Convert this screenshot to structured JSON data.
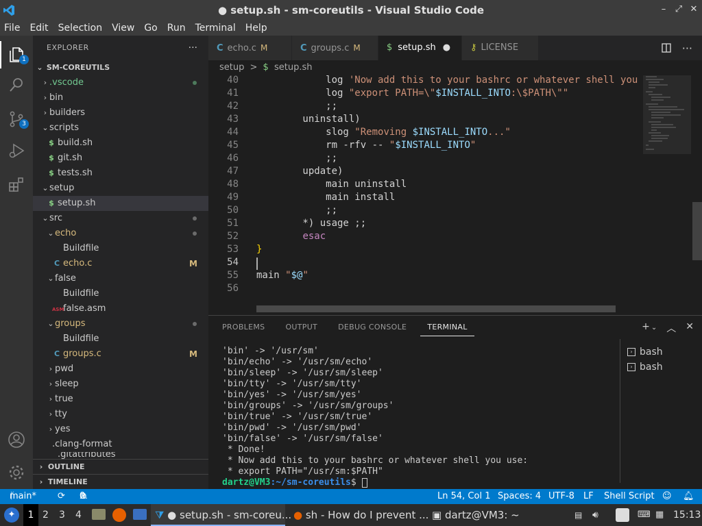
{
  "window": {
    "title": "● setup.sh - sm-coreutils - Visual Studio Code",
    "minimize_glyph": "–",
    "restore_glyph": "⤢",
    "close_glyph": "✕"
  },
  "menu": [
    "File",
    "Edit",
    "Selection",
    "View",
    "Go",
    "Run",
    "Terminal",
    "Help"
  ],
  "activity": {
    "explorer_badge": "1",
    "scm_badge": "3"
  },
  "sidebar": {
    "header": "EXPLORER",
    "more": "···",
    "root": "SM-COREUTILS",
    "items": [
      {
        "label": ".vscode",
        "indent": 1,
        "kind": "folder",
        "open": false,
        "color": "#73c991",
        "dot": true
      },
      {
        "label": "bin",
        "indent": 1,
        "kind": "folder",
        "open": false
      },
      {
        "label": "builders",
        "indent": 1,
        "kind": "folder",
        "open": false
      },
      {
        "label": "scripts",
        "indent": 1,
        "kind": "folder",
        "open": true
      },
      {
        "label": "build.sh",
        "indent": 2,
        "kind": "sh"
      },
      {
        "label": "git.sh",
        "indent": 2,
        "kind": "sh"
      },
      {
        "label": "tests.sh",
        "indent": 2,
        "kind": "sh"
      },
      {
        "label": "setup",
        "indent": 1,
        "kind": "folder",
        "open": true
      },
      {
        "label": "setup.sh",
        "indent": 2,
        "kind": "sh",
        "selected": true
      },
      {
        "label": "src",
        "indent": 1,
        "kind": "folder",
        "open": true,
        "dot": true
      },
      {
        "label": "echo",
        "indent": 2,
        "kind": "folder",
        "open": true,
        "color": "#d7ba7d",
        "dot": true
      },
      {
        "label": "Buildfile",
        "indent": 3,
        "kind": "plain"
      },
      {
        "label": "echo.c",
        "indent": 3,
        "kind": "c",
        "color": "#d7ba7d",
        "flag": "M"
      },
      {
        "label": "false",
        "indent": 2,
        "kind": "folder",
        "open": true
      },
      {
        "label": "Buildfile",
        "indent": 3,
        "kind": "plain"
      },
      {
        "label": "false.asm",
        "indent": 3,
        "kind": "asm"
      },
      {
        "label": "groups",
        "indent": 2,
        "kind": "folder",
        "open": true,
        "color": "#d7ba7d",
        "dot": true
      },
      {
        "label": "Buildfile",
        "indent": 3,
        "kind": "plain"
      },
      {
        "label": "groups.c",
        "indent": 3,
        "kind": "c",
        "color": "#d7ba7d",
        "flag": "M"
      },
      {
        "label": "pwd",
        "indent": 2,
        "kind": "folder",
        "open": false
      },
      {
        "label": "sleep",
        "indent": 2,
        "kind": "folder",
        "open": false
      },
      {
        "label": "true",
        "indent": 2,
        "kind": "folder",
        "open": false
      },
      {
        "label": "tty",
        "indent": 2,
        "kind": "folder",
        "open": false
      },
      {
        "label": "yes",
        "indent": 2,
        "kind": "folder",
        "open": false
      },
      {
        "label": ".clang-format",
        "indent": 1,
        "kind": "plain"
      }
    ],
    "partial_item": ".gitattributes",
    "outline": "OUTLINE",
    "timeline": "TIMELINE"
  },
  "tabs": [
    {
      "label": "echo.c",
      "icon": "C",
      "flag": "M",
      "active": false
    },
    {
      "label": "groups.c",
      "icon": "C",
      "flag": "M",
      "active": false
    },
    {
      "label": "setup.sh",
      "icon": "$",
      "flag": "●",
      "active": true
    },
    {
      "label": "LICENSE",
      "icon": "⚷",
      "flag": "",
      "active": false
    }
  ],
  "breadcrumb": {
    "folder": "setup",
    "sep": ">",
    "file": "setup.sh"
  },
  "code_lines": [
    {
      "n": "40",
      "segs": [
        [
          "            log ",
          "#d4d4d4"
        ],
        [
          "'Now add this to your bashrc or whatever shell you use:'",
          "#ce9178"
        ]
      ]
    },
    {
      "n": "41",
      "segs": [
        [
          "            log ",
          "#d4d4d4"
        ],
        [
          "\"export PATH=\\\"",
          "#ce9178"
        ],
        [
          "$INSTALL_INTO",
          "#9cdcfe"
        ],
        [
          ":\\$PATH\\\"\"",
          "#ce9178"
        ]
      ]
    },
    {
      "n": "42",
      "segs": [
        [
          "            ;;",
          "#d4d4d4"
        ]
      ]
    },
    {
      "n": "43",
      "segs": [
        [
          "        uninstall)",
          "#d4d4d4"
        ]
      ]
    },
    {
      "n": "44",
      "segs": [
        [
          "            slog ",
          "#d4d4d4"
        ],
        [
          "\"Removing ",
          "#ce9178"
        ],
        [
          "$INSTALL_INTO",
          "#9cdcfe"
        ],
        [
          "...\"",
          "#ce9178"
        ]
      ]
    },
    {
      "n": "45",
      "segs": [
        [
          "            rm -rfv -- ",
          "#d4d4d4"
        ],
        [
          "\"",
          "#ce9178"
        ],
        [
          "$INSTALL_INTO",
          "#9cdcfe"
        ],
        [
          "\"",
          "#ce9178"
        ]
      ]
    },
    {
      "n": "46",
      "segs": [
        [
          "            ;;",
          "#d4d4d4"
        ]
      ]
    },
    {
      "n": "47",
      "segs": [
        [
          "        update)",
          "#d4d4d4"
        ]
      ]
    },
    {
      "n": "48",
      "segs": [
        [
          "            main uninstall",
          "#d4d4d4"
        ]
      ]
    },
    {
      "n": "49",
      "segs": [
        [
          "            main install",
          "#d4d4d4"
        ]
      ]
    },
    {
      "n": "50",
      "segs": [
        [
          "            ;;",
          "#d4d4d4"
        ]
      ]
    },
    {
      "n": "51",
      "segs": [
        [
          "        *) usage ;;",
          "#d4d4d4"
        ]
      ]
    },
    {
      "n": "52",
      "segs": [
        [
          "        ",
          "#d4d4d4"
        ],
        [
          "esac",
          "#c586c0"
        ]
      ]
    },
    {
      "n": "53",
      "segs": [
        [
          "}",
          "#ffd700"
        ]
      ]
    },
    {
      "n": "54",
      "segs": [
        [
          "",
          "#d4d4d4"
        ]
      ]
    },
    {
      "n": "55",
      "segs": [
        [
          "main ",
          "#d4d4d4"
        ],
        [
          "\"",
          "#ce9178"
        ],
        [
          "$@",
          "#9cdcfe"
        ],
        [
          "\"",
          "#ce9178"
        ]
      ]
    },
    {
      "n": "56",
      "segs": [
        [
          "",
          "#d4d4d4"
        ]
      ]
    }
  ],
  "panel": {
    "tabs": [
      "PROBLEMS",
      "OUTPUT",
      "DEBUG CONSOLE",
      "TERMINAL"
    ],
    "active_tab": "TERMINAL",
    "add": "+",
    "terminal_lines": [
      "'bin' -> '/usr/sm'",
      "'bin/echo' -> '/usr/sm/echo'",
      "'bin/sleep' -> '/usr/sm/sleep'",
      "'bin/tty' -> '/usr/sm/tty'",
      "'bin/yes' -> '/usr/sm/yes'",
      "'bin/groups' -> '/usr/sm/groups'",
      "'bin/true' -> '/usr/sm/true'",
      "'bin/pwd' -> '/usr/sm/pwd'",
      "'bin/false' -> '/usr/sm/false'",
      " * Done!",
      " * Now add this to your bashrc or whatever shell you use:",
      " * export PATH=\"/usr/sm:$PATH\""
    ],
    "prompt_user": "dartz@VM3",
    "prompt_path": ":~/sm-coreutils",
    "prompt_sym": "$",
    "terminals": [
      "bash",
      "bash"
    ]
  },
  "status": {
    "branch": "main*",
    "errors": "0",
    "warnings": "0",
    "position": "Ln 54, Col 1",
    "spaces": "Spaces: 4",
    "encoding": "UTF-8",
    "eol": "LF",
    "language": "Shell Script"
  },
  "taskbar": {
    "workspaces": [
      "1",
      "2",
      "3",
      "4"
    ],
    "tasks": [
      {
        "label": "● setup.sh - sm-coreu...",
        "active": true
      },
      {
        "label": "sh - How do I prevent ...",
        "active": false
      },
      {
        "label": "dartz@VM3: ~",
        "active": false
      }
    ],
    "clock": "15:13"
  },
  "colors": {
    "accent": "#007acc",
    "modified": "#d7ba7d",
    "untracked": "#73c991",
    "prompt": "#23d18b",
    "path": "#3b8eea"
  }
}
